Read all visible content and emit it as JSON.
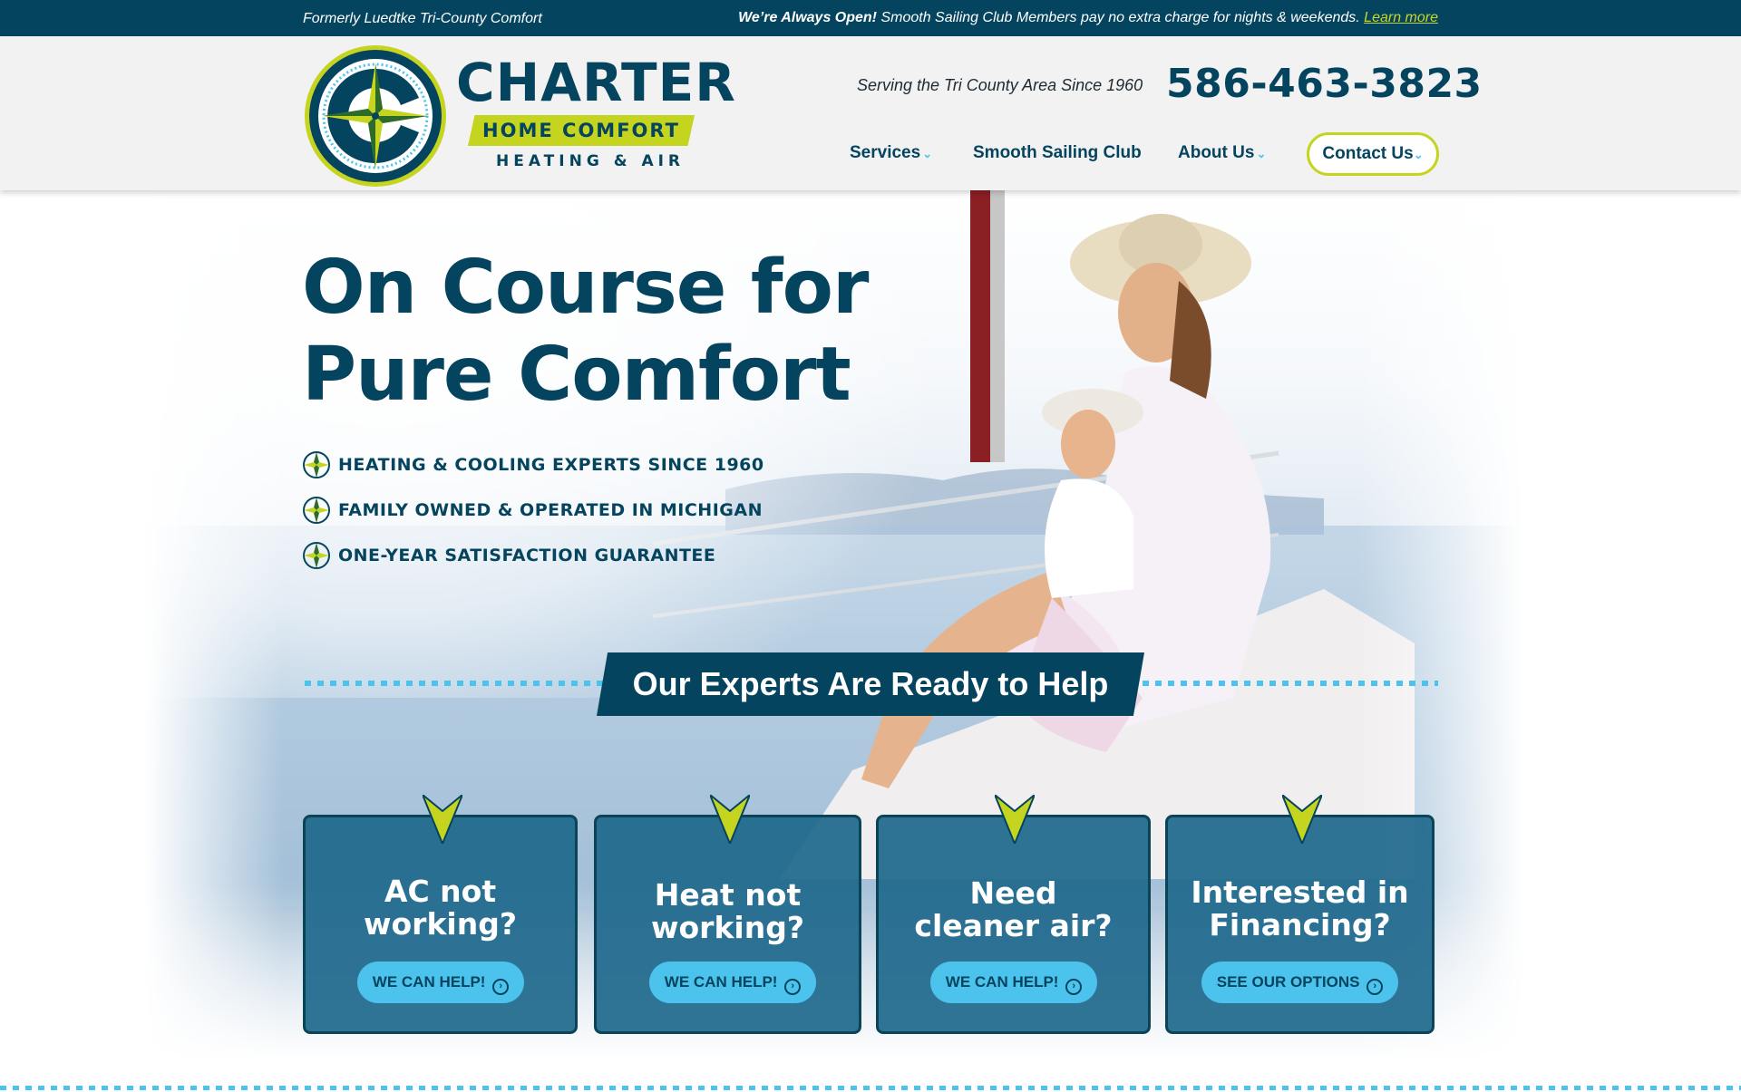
{
  "topbar": {
    "left_text": "Formerly Luedtke Tri-County Comfort",
    "open_bold": "We’re Always Open!",
    "open_text": " Smooth Sailing Club Members pay no extra charge for nights & weekends. ",
    "learn_more": "Learn more"
  },
  "header": {
    "logo_word": "CHARTER",
    "logo_band": "HOME COMFORT",
    "logo_sub": "HEATING & AIR",
    "tagline": "Serving the Tri County Area Since 1960",
    "phone": "586-463-3823",
    "nav": {
      "services": "Services",
      "club": "Smooth Sailing Club",
      "about": "About Us",
      "contact": "Contact Us"
    },
    "caret_glyph": "⌄"
  },
  "hero": {
    "headline_1": "On Course for",
    "headline_2": "Pure Comfort",
    "bullets": [
      "HEATING & COOLING EXPERTS SINCE 1960",
      "FAMILY OWNED & OPERATED IN MICHIGAN",
      "ONE-YEAR SATISFACTION GUARANTEE"
    ],
    "banner": "Our Experts Are Ready to Help"
  },
  "cards": [
    {
      "title_1": "AC not",
      "title_2": "working?",
      "button": "WE CAN HELP!"
    },
    {
      "title_1": "Heat not",
      "title_2": "working?",
      "button": "WE CAN HELP!"
    },
    {
      "title_1": "Need",
      "title_2": "cleaner air?",
      "button": "WE CAN HELP!"
    },
    {
      "title_1": "Interested in",
      "title_2": "Financing?",
      "button": "SEE OUR OPTIONS"
    }
  ],
  "colors": {
    "navy": "#05445e",
    "lime": "#c5d41f",
    "sky": "#4cc3ec"
  },
  "icons": {
    "compass": "compass-star-icon",
    "arrow": "arrow-circle-right-icon"
  }
}
